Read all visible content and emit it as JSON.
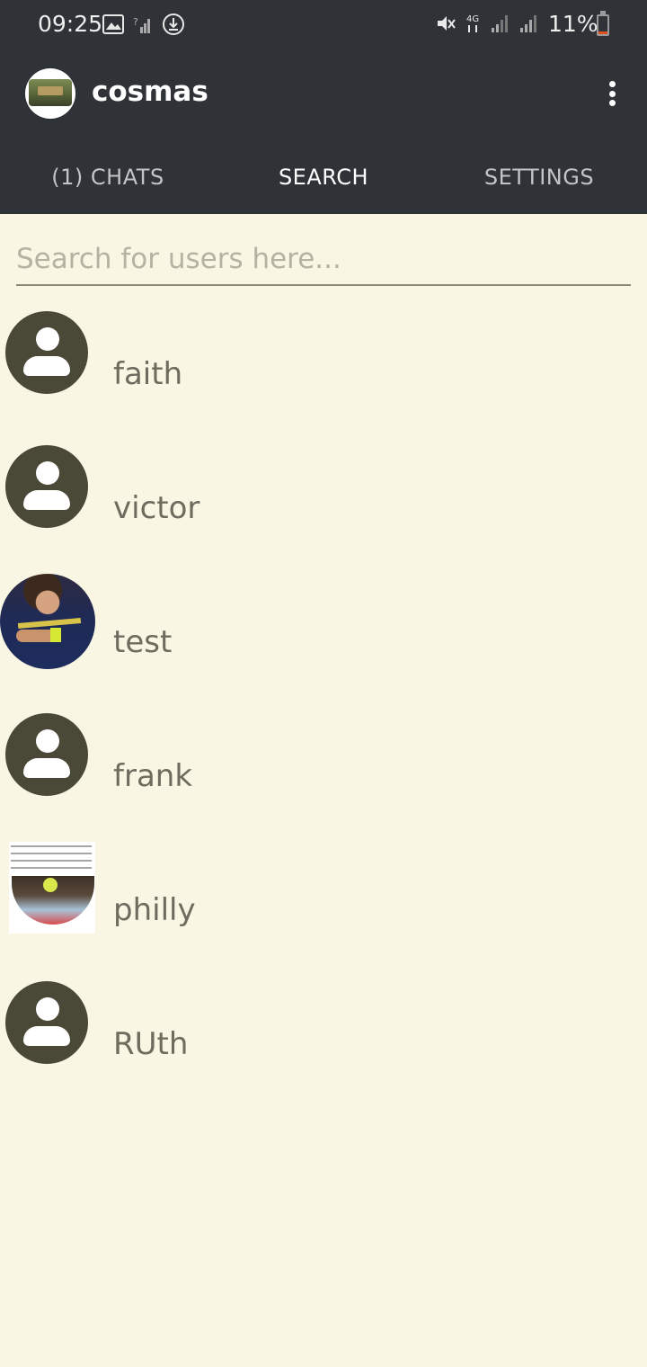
{
  "status_bar": {
    "time": "09:25",
    "battery": "11%",
    "battery_level": 0.11,
    "icons_left": [
      "image-icon",
      "signal-question-icon",
      "download-icon"
    ],
    "icons_right": [
      "mute-icon",
      "4g-icon",
      "signal-icon",
      "signal-icon"
    ]
  },
  "app_bar": {
    "title": "cosmas",
    "menu_icon": "more-vert-icon"
  },
  "tabs": [
    {
      "label": "(1) CHATS"
    },
    {
      "label": "SEARCH"
    },
    {
      "label": "SETTINGS"
    }
  ],
  "search": {
    "placeholder": "Search for users here...",
    "value": ""
  },
  "users": [
    {
      "name": "faith",
      "avatar": "default-person-icon"
    },
    {
      "name": "victor",
      "avatar": "default-person-icon"
    },
    {
      "name": "test",
      "avatar": "photo"
    },
    {
      "name": "frank",
      "avatar": "default-person-icon"
    },
    {
      "name": "philly",
      "avatar": "photo"
    },
    {
      "name": "RUth",
      "avatar": "default-person-icon"
    }
  ],
  "colors": {
    "app_bar_bg": "#2f3237",
    "page_bg": "#f9f7e4",
    "avatar_bg": "#4a4837",
    "name_text": "#6d6c5e",
    "battery_low": "#e0521f"
  }
}
